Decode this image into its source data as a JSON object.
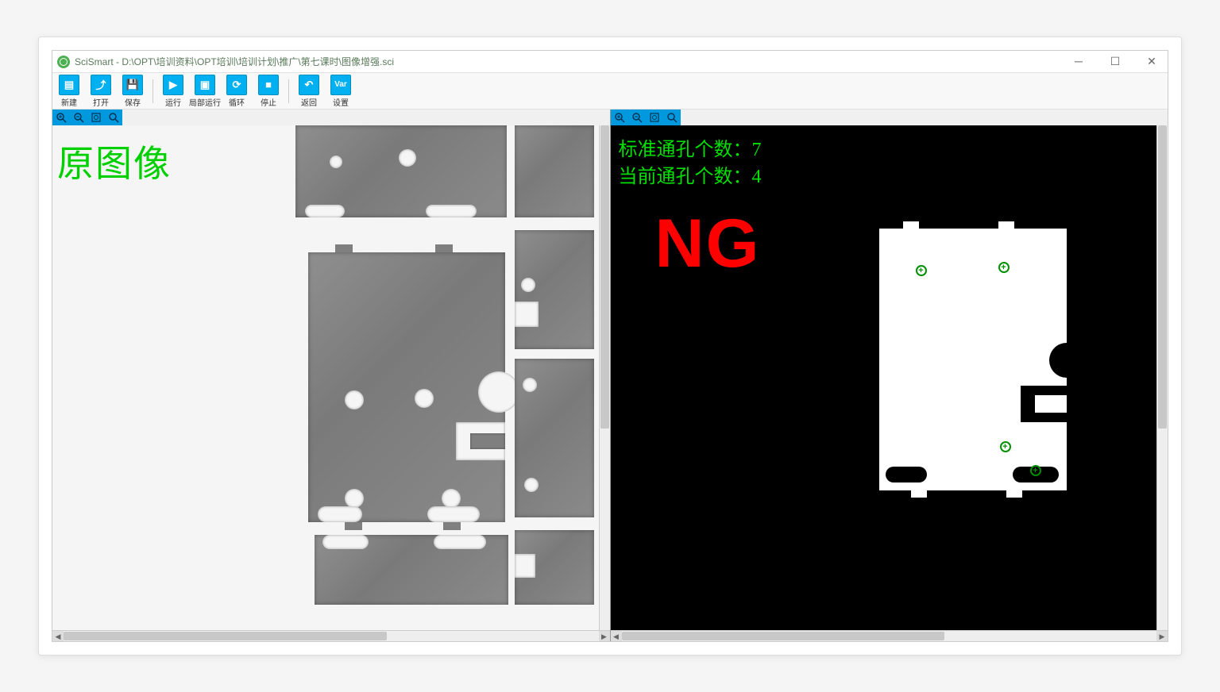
{
  "window": {
    "title": "SciSmart - D:\\OPT\\培训资料\\OPT培训\\培训计划\\推广\\第七课时\\图像增强.sci"
  },
  "toolbar": {
    "items": [
      {
        "icon": "new",
        "label": "新建"
      },
      {
        "icon": "open",
        "label": "打开"
      },
      {
        "icon": "save",
        "label": "保存"
      },
      {
        "icon": "run",
        "label": "运行"
      },
      {
        "icon": "step",
        "label": "局部运行"
      },
      {
        "icon": "loop",
        "label": "循环"
      },
      {
        "icon": "stop",
        "label": "停止"
      },
      {
        "icon": "back",
        "label": "返回"
      },
      {
        "icon": "var",
        "label": "设置"
      }
    ]
  },
  "zoom": {
    "btns": [
      "zoom-in",
      "zoom-out",
      "zoom-fit",
      "zoom-reset"
    ]
  },
  "left": {
    "overlay_label": "原图像"
  },
  "right": {
    "standard_label": "标准通孔个数：",
    "standard_value": "7",
    "current_label": "当前通孔个数：",
    "current_value": "4",
    "result": "NG"
  }
}
